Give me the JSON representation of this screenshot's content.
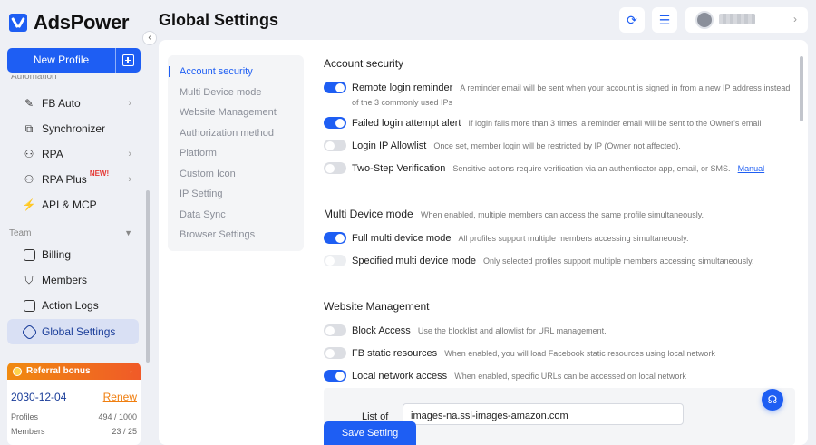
{
  "app": {
    "name": "AdsPower"
  },
  "header": {
    "title": "Global Settings"
  },
  "sidebar": {
    "new_profile_label": "New Profile",
    "cut_label": "Automation",
    "items": [
      {
        "label": "FB Auto",
        "icon": "fb-auto-icon",
        "chevron": true
      },
      {
        "label": "Synchronizer",
        "icon": "synchronizer-icon"
      },
      {
        "label": "RPA",
        "icon": "rpa-icon",
        "chevron": true
      },
      {
        "label": "RPA Plus",
        "icon": "rpa-plus-icon",
        "badge": "NEW!",
        "chevron": true
      },
      {
        "label": "API & MCP",
        "icon": "api-icon"
      }
    ],
    "team_label": "Team",
    "team_items": [
      {
        "label": "Billing",
        "icon": "billing-icon"
      },
      {
        "label": "Members",
        "icon": "members-icon"
      },
      {
        "label": "Action Logs",
        "icon": "action-logs-icon"
      },
      {
        "label": "Global Settings",
        "icon": "global-settings-icon",
        "active": true
      }
    ]
  },
  "referral": {
    "title": "Referral bonus",
    "date": "2030-12-04",
    "renew": "Renew",
    "profiles_label": "Profiles",
    "profiles_value": "494 / 1000",
    "members_label": "Members",
    "members_value": "23 / 25",
    "accent": "#f07f10"
  },
  "subnav": [
    {
      "label": "Account security",
      "active": true
    },
    {
      "label": "Multi Device mode"
    },
    {
      "label": "Website Management"
    },
    {
      "label": "Authorization method"
    },
    {
      "label": "Platform"
    },
    {
      "label": "Custom Icon"
    },
    {
      "label": "IP Setting"
    },
    {
      "label": "Data Sync"
    },
    {
      "label": "Browser Settings"
    }
  ],
  "sections": {
    "account_security": {
      "title": "Account security",
      "rows": [
        {
          "label": "Remote login reminder",
          "desc": "A reminder email will be sent when your account is signed in from a new IP address instead of the 3 commonly used IPs",
          "on": true
        },
        {
          "label": "Failed login attempt alert",
          "desc": "If login fails more than 3 times, a reminder email will be sent to the Owner's email",
          "on": true
        },
        {
          "label": "Login IP Allowlist",
          "desc": "Once set, member login will be restricted by IP (Owner not affected).",
          "on": false
        },
        {
          "label": "Two-Step Verification",
          "desc": "Sensitive actions require verification via an authenticator app, email, or SMS.",
          "link": "Manual",
          "on": false
        }
      ]
    },
    "multi_device": {
      "title": "Multi Device mode",
      "desc": "When enabled, multiple members can access the same profile simultaneously.",
      "rows": [
        {
          "label": "Full multi device mode",
          "desc": "All profiles support multiple members accessing simultaneously.",
          "on": true
        },
        {
          "label": "Specified multi device mode",
          "desc": "Only selected profiles support multiple members accessing simultaneously.",
          "on": false
        }
      ]
    },
    "website_management": {
      "title": "Website Management",
      "rows": [
        {
          "label": "Block Access",
          "desc": "Use the blocklist and allowlist for URL management.",
          "on": false
        },
        {
          "label": "FB static resources",
          "desc": "When enabled, you will load Facebook static resources using local network",
          "on": false
        },
        {
          "label": "Local network access",
          "desc": "When enabled, specific URLs can be accessed on local network",
          "on": true
        }
      ],
      "list_label": "List of",
      "list_value": "images-na.ssl-images-amazon.com"
    }
  },
  "save_label": "Save Setting",
  "colors": {
    "primary": "#1e5ef3",
    "active_nav": "#d9e0f4",
    "new_badge": "#e53935"
  }
}
